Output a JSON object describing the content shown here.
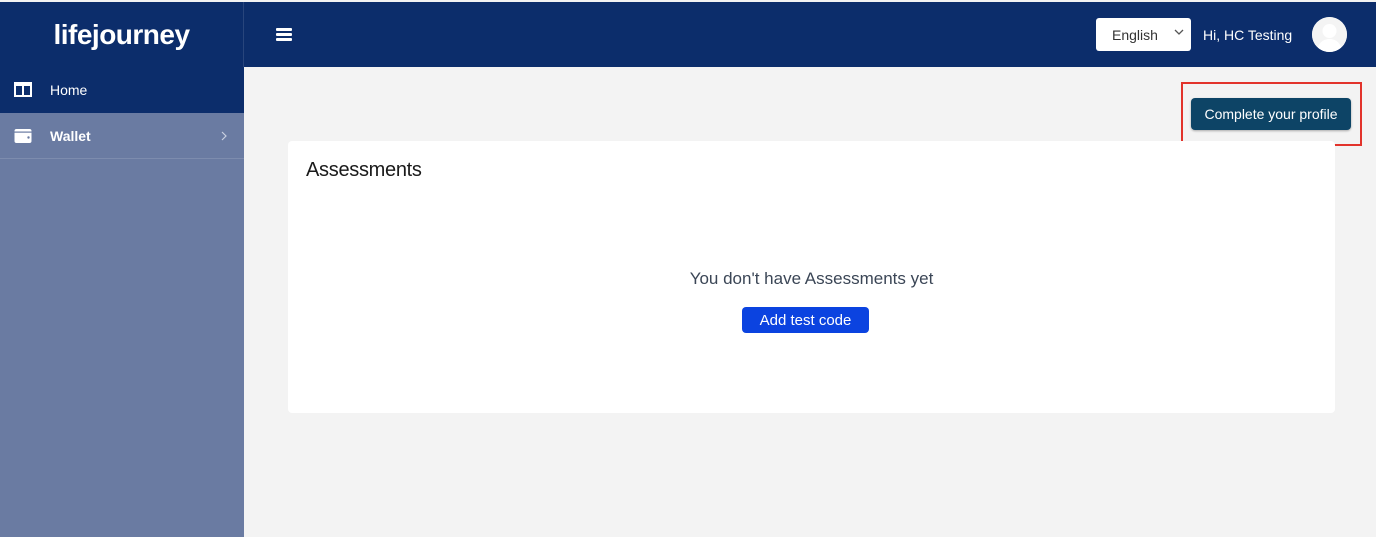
{
  "header": {
    "logo_text": "lifejourney",
    "language": "English",
    "greeting": "Hi, HC Testing"
  },
  "sidebar": {
    "items": [
      {
        "label": "Home",
        "icon": "columns-icon"
      },
      {
        "label": "Wallet",
        "icon": "wallet-icon"
      }
    ]
  },
  "main": {
    "complete_profile_label": "Complete your profile",
    "card": {
      "title": "Assessments",
      "empty_message": "You don't have Assessments yet",
      "add_button_label": "Add test code"
    }
  },
  "colors": {
    "navbar": "#0c2d6b",
    "sidebar": "#6a7ba2",
    "profile_button": "#0d4466",
    "add_button": "#0b43e0",
    "highlight": "#e2332b"
  }
}
